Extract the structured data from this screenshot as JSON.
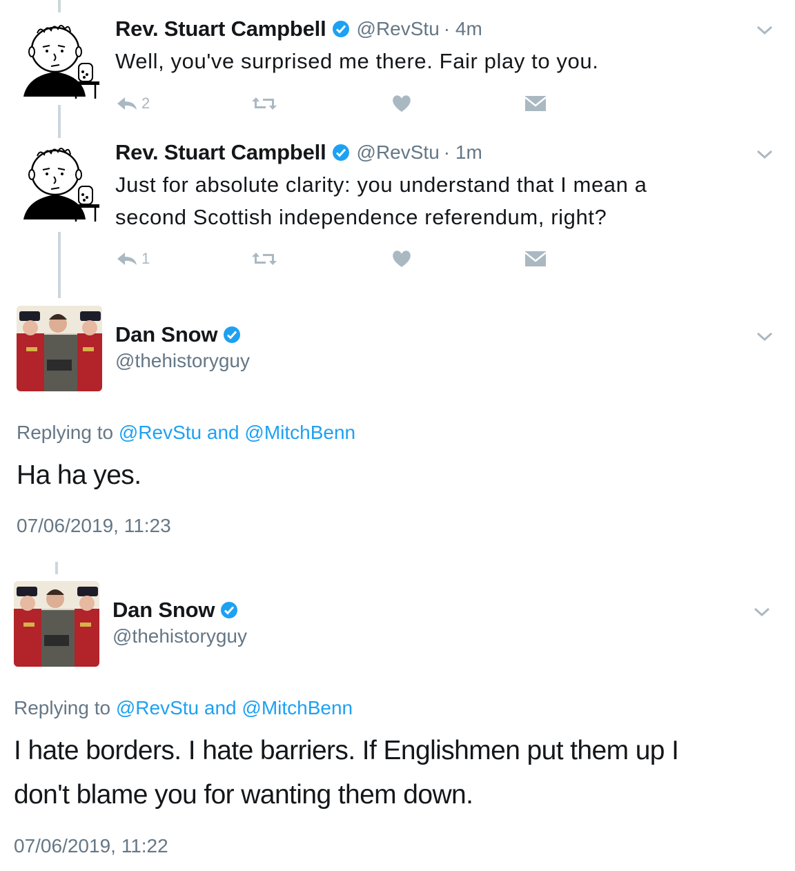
{
  "tweets": [
    {
      "name": "Rev. Stuart Campbell",
      "handle": "@RevStu",
      "time": "· 4m",
      "text": "Well, you've surprised me there. Fair play to you.",
      "reply_count": "2"
    },
    {
      "name": "Rev. Stuart Campbell",
      "handle": "@RevStu",
      "time": "· 1m",
      "text_line1": "Just for absolute clarity: you understand that I mean a",
      "text_line2": "second Scottish independence referendum, right?",
      "reply_count": "1"
    }
  ],
  "expanded": [
    {
      "name": "Dan Snow",
      "handle": "@thehistoryguy",
      "replying_prefix": "Replying to",
      "mention1": "@RevStu",
      "and": "and",
      "mention2": "@MitchBenn",
      "text": "Ha ha yes.",
      "timestamp": "07/06/2019, 11:23"
    },
    {
      "name": "Dan Snow",
      "handle": "@thehistoryguy",
      "replying_prefix": "Replying to",
      "mention1": "@RevStu",
      "and": "and",
      "mention2": "@MitchBenn",
      "text_line1": "I hate borders. I hate barriers. If Englishmen put them up I",
      "text_line2": "don't blame you for wanting them down.",
      "timestamp": "07/06/2019, 11:22"
    }
  ],
  "colors": {
    "link": "#1da1f2",
    "secondary": "#657786",
    "icon": "#aab8c2",
    "thread_line": "#ccd6dd",
    "verified": "#1da1f2"
  },
  "icons": [
    "reply-icon",
    "retweet-icon",
    "like-icon",
    "direct-message-icon",
    "chevron-down-icon",
    "verified-badge-icon"
  ]
}
